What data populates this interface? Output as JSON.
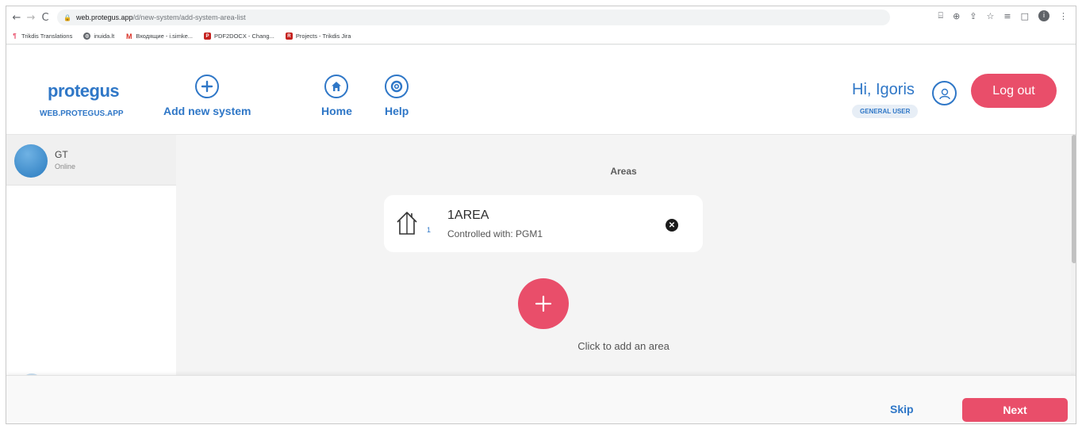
{
  "browser": {
    "url_host": "web.protegus.app",
    "url_path": "/d/new-system/add-system-area-list",
    "bookmarks": [
      {
        "label": "Trikdis Translations"
      },
      {
        "label": "inuida.lt"
      },
      {
        "label": "Входящие - i.simke..."
      },
      {
        "label": "PDF2DOCX - Chang..."
      },
      {
        "label": "Projects - Trikdis Jira"
      }
    ]
  },
  "header": {
    "logo": "protegus",
    "logo_sub": "WEB.PROTEGUS.APP",
    "nav": {
      "add_system": "Add new system",
      "home": "Home",
      "help": "Help"
    },
    "greeting": "Hi, Igoris",
    "role": "GENERAL USER",
    "logout": "Log out"
  },
  "sidebar": {
    "systems": [
      {
        "name": "GT",
        "status": "Online"
      }
    ]
  },
  "main": {
    "title": "Areas",
    "areas": [
      {
        "number": "1",
        "name": "1AREA",
        "controlled_with": "Controlled with: PGM1"
      }
    ],
    "add_label": "Click to add an area"
  },
  "footer": {
    "skip": "Skip",
    "next": "Next"
  },
  "colors": {
    "brand_blue": "#2f77c7",
    "accent_pink": "#e94e6a"
  }
}
